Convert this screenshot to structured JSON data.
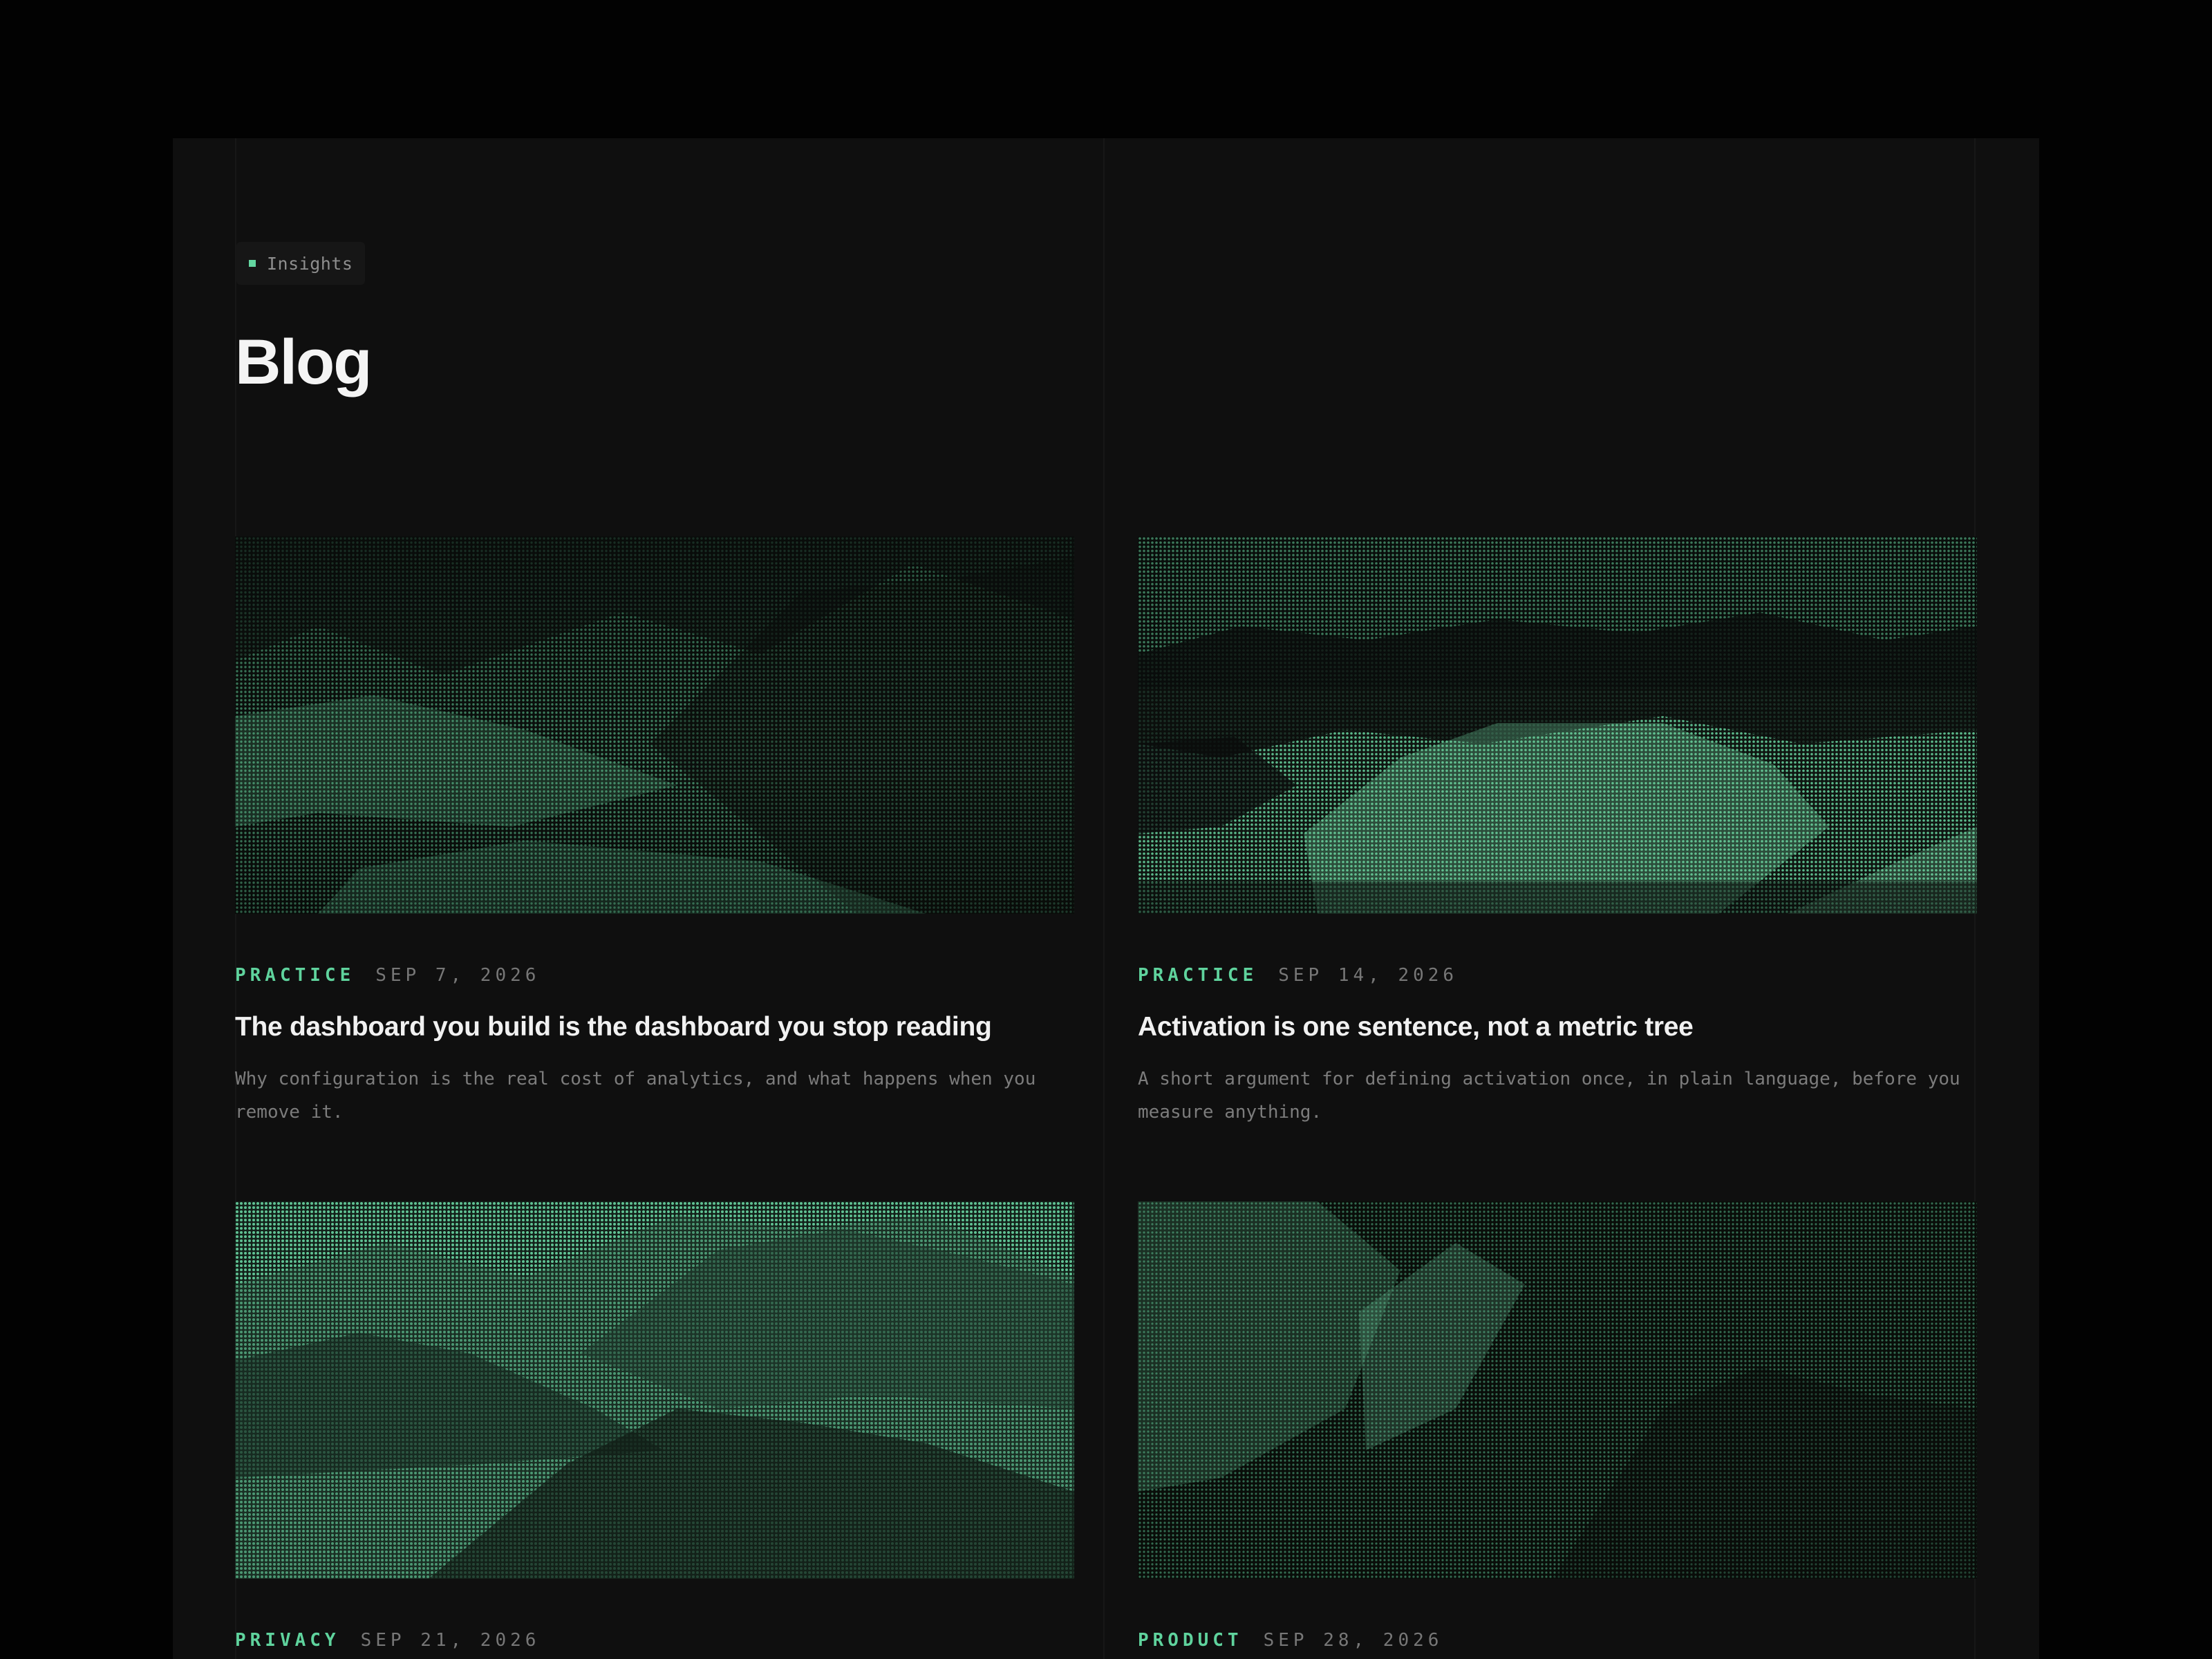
{
  "header": {
    "badge_label": "Insights",
    "title": "Blog"
  },
  "colors": {
    "accent": "#5fd39d",
    "background": "#0f0f0f",
    "image_tint": "#4fa77d"
  },
  "posts": [
    {
      "category": "PRACTICE",
      "date": "SEP 7, 2026",
      "title": "The dashboard you build is the dashboard you stop reading",
      "excerpt": "Why configuration is the real cost of analytics, and what happens when you remove it."
    },
    {
      "category": "PRACTICE",
      "date": "SEP 14, 2026",
      "title": "Activation is one sentence, not a metric tree",
      "excerpt": "A short argument for defining activation once, in plain language, before you measure anything."
    },
    {
      "category": "PRIVACY",
      "date": "SEP 21, 2026",
      "title": "",
      "excerpt": ""
    },
    {
      "category": "PRODUCT",
      "date": "SEP 28, 2026",
      "title": "",
      "excerpt": ""
    }
  ]
}
